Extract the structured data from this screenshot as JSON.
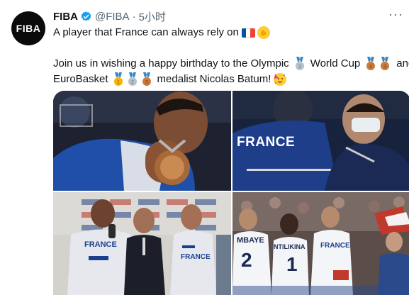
{
  "tweet": {
    "avatar_text": "FIBA",
    "author_name": "FIBA",
    "handle": "@FIBA",
    "separator": "·",
    "time": "5小时",
    "more_icon": "more-icon",
    "verified_icon": "verified-badge-icon",
    "line1": "A player that France can always rely on",
    "line2_a": "Join us in wishing a happy birthday to the Olympic",
    "line2_b": "World Cup",
    "line2_c": "and",
    "line3_a": "EuroBasket",
    "line3_b": "medalist Nicolas Batum!",
    "emojis": [
      "flag-france-icon",
      "flexed-hand-icon",
      "silver-medal-icon",
      "bronze-medal-icon",
      "gold-medal-icon",
      "party-face-icon"
    ]
  },
  "media": {
    "photo2_jersey_text": "FRANCE",
    "photo3_jersey_left": "FRANCE",
    "photo3_jersey_right": "FRANCE",
    "photo4_player1_name": "MBAYE",
    "photo4_player1_number": "2",
    "photo4_player2_name": "NTILIKINA",
    "photo4_player2_number": "1",
    "photo4_player3_name": "FRANCE"
  },
  "colors": {
    "accent_blue": "#1d9bf0",
    "text_primary": "#0f1419",
    "text_secondary": "#536471",
    "flag_blue": "#0055a4",
    "flag_red": "#ef4135",
    "gold": "#f5b300",
    "silver": "#b9c0c7",
    "bronze": "#c97a3e"
  }
}
